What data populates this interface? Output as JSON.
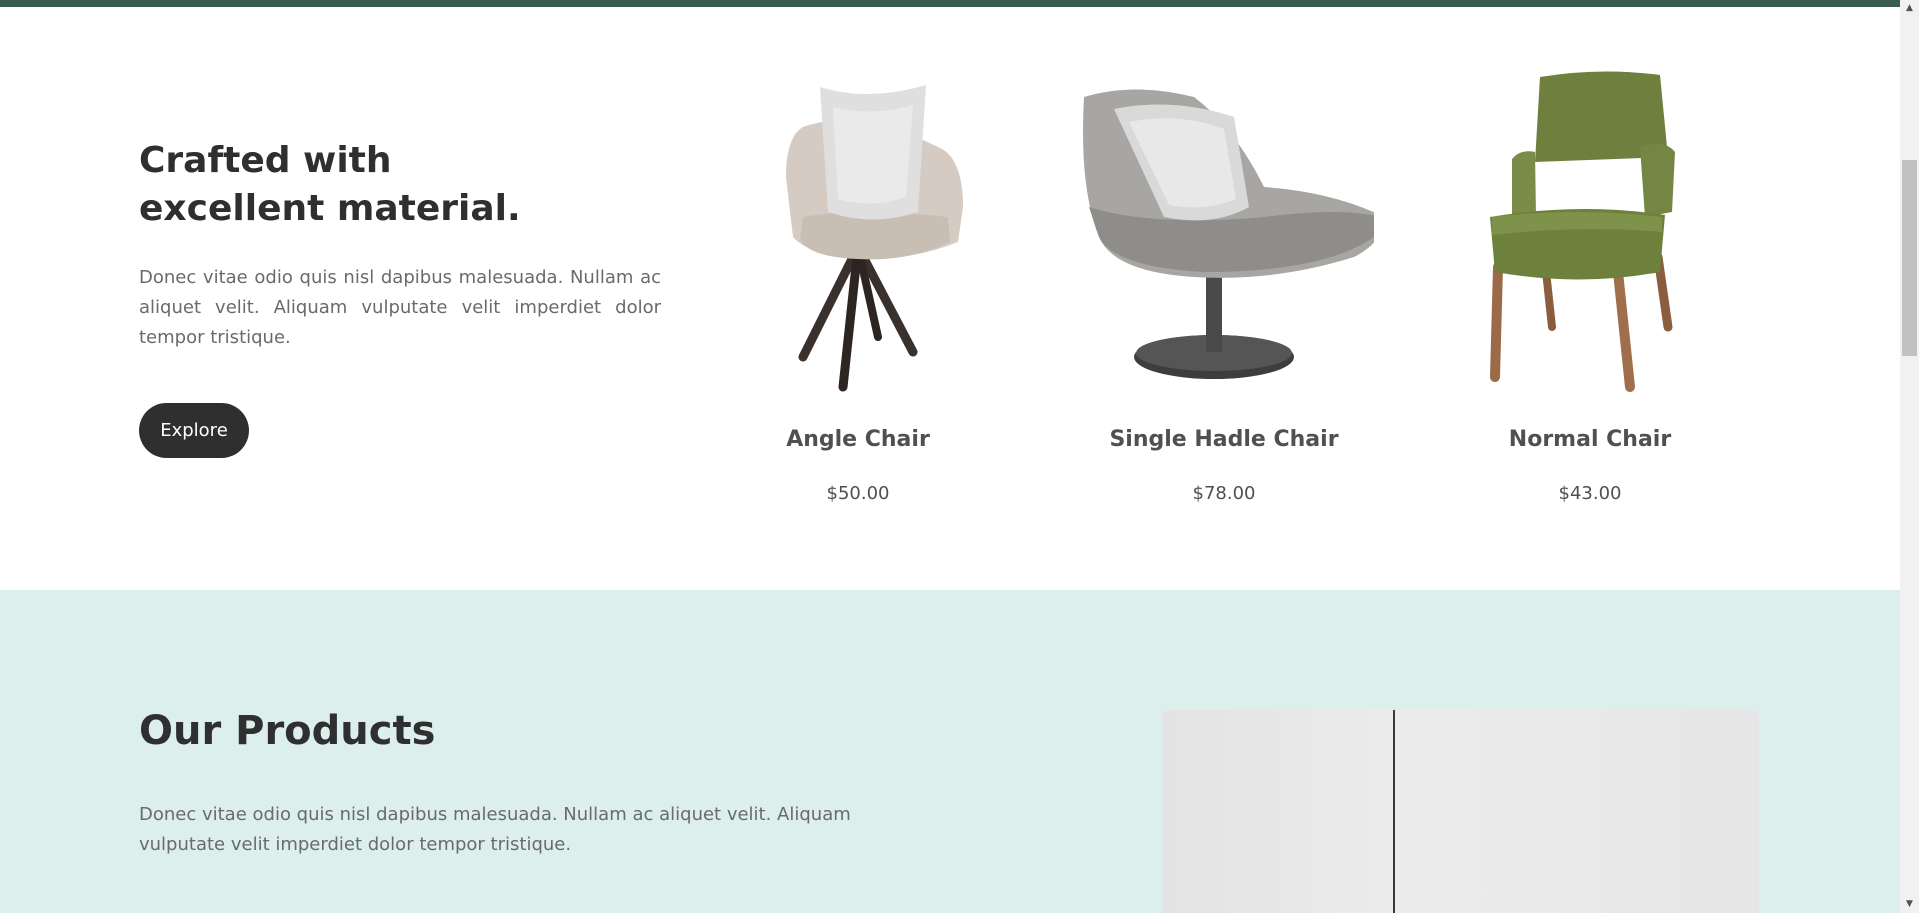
{
  "craft_section": {
    "heading_line1": "Crafted with",
    "heading_line2": "excellent material.",
    "description": "Donec vitae odio quis nisl dapibus malesuada. Nullam ac aliquet velit. Aliquam vulputate velit imperdiet dolor tempor tristique.",
    "button_label": "Explore"
  },
  "products_list": [
    {
      "name": "Angle Chair",
      "price": "$50.00"
    },
    {
      "name": "Single Hadle Chair",
      "price": "$78.00"
    },
    {
      "name": "Normal Chair",
      "price": "$43.00"
    }
  ],
  "products_section": {
    "heading": "Our Products",
    "description": "Donec vitae odio quis nisl dapibus malesuada. Nullam ac aliquet velit. Aliquam vulputate velit imperdiet dolor tempor tristique."
  },
  "colors": {
    "top_bar": "#3b5d50",
    "button_bg": "#2f2f2f",
    "products_bg": "#dcefec"
  },
  "icons": {
    "scroll_up": "▲",
    "scroll_down": "▼"
  }
}
